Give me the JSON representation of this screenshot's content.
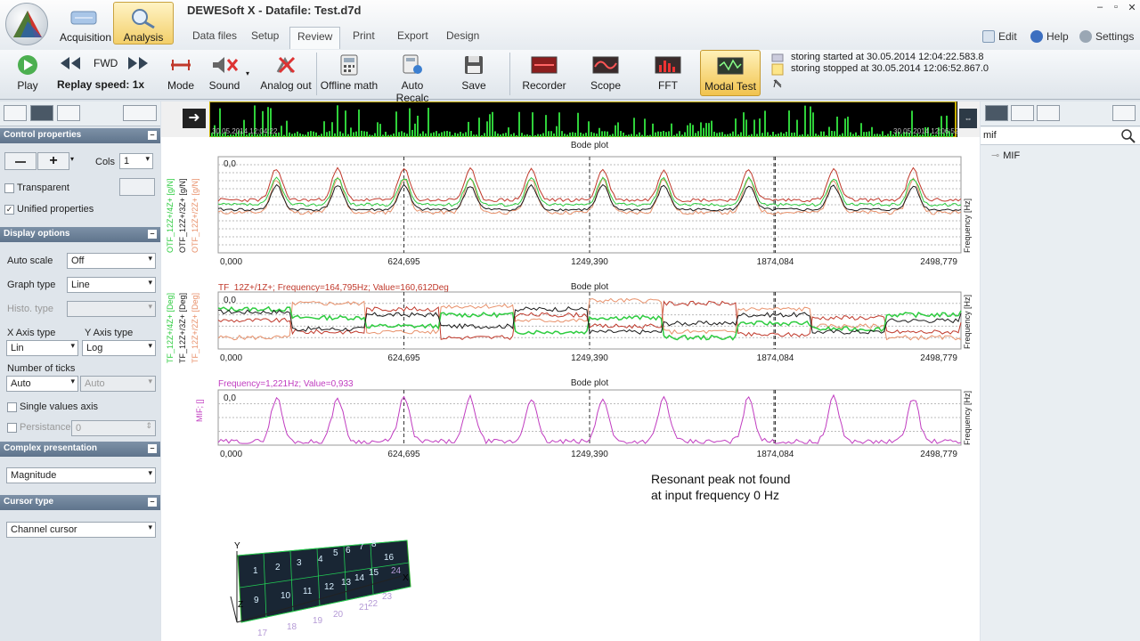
{
  "app": {
    "title": "DEWESoft X - Datafile: Test.d7d"
  },
  "modes": [
    {
      "label": "Acquisition",
      "icon": "acquisition-icon"
    },
    {
      "label": "Analysis",
      "icon": "analysis-icon"
    }
  ],
  "tabs": [
    "Data files",
    "Setup",
    "Review",
    "Print",
    "Export",
    "Design"
  ],
  "header_buttons": {
    "edit": "Edit",
    "help": "Help",
    "settings": "Settings"
  },
  "toolbar": {
    "play": "Play",
    "fwd": "FWD",
    "replay_speed": "Replay speed: 1x",
    "mode": "Mode",
    "sound": "Sound",
    "analog_out": "Analog out",
    "offline_math": "Offline math",
    "auto_recalc": "Auto Recalc",
    "save": "Save",
    "recorder": "Recorder",
    "scope": "Scope",
    "fft": "FFT",
    "modal_test": "Modal Test"
  },
  "messages": [
    "storing started at 30.05.2014 12:04:22.583.8",
    "storing stopped at 30.05.2014 12:06:52.867.0"
  ],
  "timeline": {
    "start": "30.05.2014 12:04:22",
    "end": "30.05.2014 12:06:52"
  },
  "sidebar": {
    "control_properties": "Control properties",
    "cols_label": "Cols",
    "cols_value": "1",
    "transparent": "Transparent",
    "unified": "Unified properties",
    "display_options": "Display options",
    "auto_scale_label": "Auto scale",
    "auto_scale": "Off",
    "graph_type_label": "Graph type",
    "graph_type": "Line",
    "histo_type_label": "Histo. type",
    "x_axis_label": "X Axis type",
    "x_axis": "Lin",
    "y_axis_label": "Y Axis type",
    "y_axis": "Log",
    "ticks_label": "Number of ticks",
    "ticks": "Auto",
    "ticks2": "Auto",
    "single_values": "Single values axis",
    "persistance_label": "Persistance",
    "persistance": "0",
    "complex_label": "Complex presentation",
    "complex": "Magnitude",
    "cursor_label": "Cursor type",
    "cursor": "Channel cursor"
  },
  "right_panel": {
    "search": "mif",
    "item": "MIF"
  },
  "plots": {
    "title": "Bode plot",
    "x_ticks": [
      "0,000",
      "624,695",
      "1249,390",
      "1874,084",
      "2498,779"
    ],
    "x_axis_label": "Frequency [Hz]",
    "p1": {
      "zero": "0,0",
      "y_labels": [
        "OTF_12Z+/2Z+ [g/N]",
        "OTF_12Z+/3Z+ [g/N]",
        "OTF_12Z+/4Z+ [g/N]"
      ]
    },
    "p2": {
      "cursor": "TF_12Z+/1Z+; Frequency=164,795Hz; Value=160,612Deg",
      "zero": "0,0",
      "y_labels": [
        "TF_12Z+/2Z+ [Deg]",
        "TF_12Z+/3Z+ [Deg]",
        "TF_12Z+/4Z+ [Deg]"
      ]
    },
    "p3": {
      "cursor": "Frequency=1,221Hz; Value=0,933",
      "zero": "0,0",
      "y_label": "MIF; []"
    }
  },
  "message_text": [
    "Resonant peak not found",
    "at input frequency 0 Hz"
  ],
  "model": {
    "axes": [
      "X",
      "Y",
      "Z"
    ],
    "nodes": [
      "1",
      "2",
      "3",
      "4",
      "5",
      "6",
      "7",
      "8",
      "9",
      "10",
      "11",
      "12",
      "13",
      "14",
      "15",
      "16",
      "17",
      "18",
      "19",
      "20",
      "21",
      "22",
      "23",
      "24"
    ]
  },
  "colors": {
    "black": "#1a1a1a",
    "red": "#c0392b",
    "green": "#2ecc40",
    "salmon": "#e8916b",
    "magenta": "#c03cc0"
  }
}
